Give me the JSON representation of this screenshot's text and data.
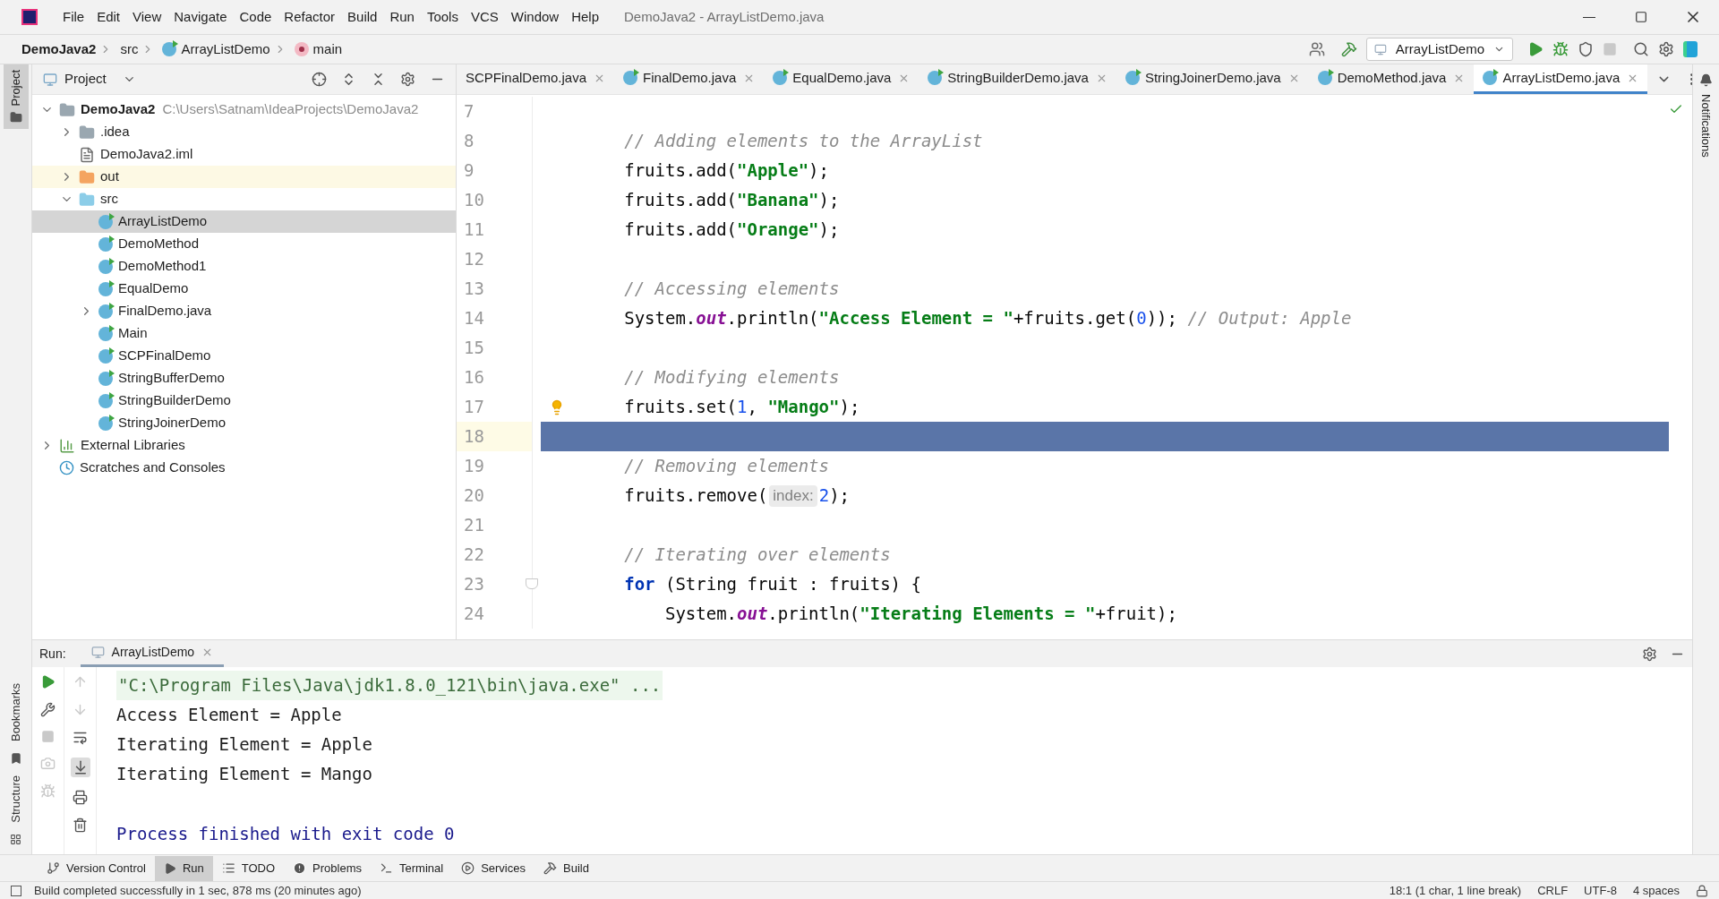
{
  "window": {
    "title": "DemoJava2 - ArrayListDemo.java"
  },
  "menu": [
    "File",
    "Edit",
    "View",
    "Navigate",
    "Code",
    "Refactor",
    "Build",
    "Run",
    "Tools",
    "VCS",
    "Window",
    "Help"
  ],
  "breadcrumb": [
    {
      "label": "DemoJava2",
      "kind": "project"
    },
    {
      "label": "src",
      "kind": "folder"
    },
    {
      "label": "ArrayListDemo",
      "kind": "class"
    },
    {
      "label": "main",
      "kind": "method"
    }
  ],
  "run_config": "ArrayListDemo",
  "left_strip": {
    "top": [
      "Project"
    ],
    "bottom": [
      "Bookmarks",
      "Structure"
    ]
  },
  "right_strip": [
    "Notifications"
  ],
  "project_panel": {
    "title": "Project",
    "tree": [
      {
        "name": "DemoJava2",
        "path": "C:\\Users\\Satnam\\IdeaProjects\\DemoJava2",
        "kind": "module",
        "expanded": true,
        "selected": false,
        "children": [
          {
            "name": ".idea",
            "kind": "folder",
            "expanded": false,
            "selected": false
          },
          {
            "name": "DemoJava2.iml",
            "kind": "iml",
            "selected": false
          },
          {
            "name": "out",
            "kind": "excluded",
            "expanded": false,
            "selected": false
          },
          {
            "name": "src",
            "kind": "source",
            "expanded": true,
            "selected": false,
            "children": [
              {
                "name": "ArrayListDemo",
                "kind": "class",
                "selected": true
              },
              {
                "name": "DemoMethod",
                "kind": "class",
                "selected": false
              },
              {
                "name": "DemoMethod1",
                "kind": "class",
                "selected": false
              },
              {
                "name": "EqualDemo",
                "kind": "class",
                "selected": false
              },
              {
                "name": "FinalDemo.java",
                "kind": "class",
                "expanded": false,
                "selected": false
              },
              {
                "name": "Main",
                "kind": "class",
                "selected": false
              },
              {
                "name": "SCPFinalDemo",
                "kind": "class",
                "selected": false
              },
              {
                "name": "StringBufferDemo",
                "kind": "class",
                "selected": false
              },
              {
                "name": "StringBuilderDemo",
                "kind": "class",
                "selected": false
              },
              {
                "name": "StringJoinerDemo",
                "kind": "class",
                "selected": false
              }
            ]
          }
        ]
      },
      {
        "name": "External Libraries",
        "kind": "libraries",
        "expanded": false,
        "selected": false
      },
      {
        "name": "Scratches and Consoles",
        "kind": "scratches",
        "selected": false
      }
    ]
  },
  "tabs": [
    {
      "label": "SCPFinalDemo.java",
      "selected": false
    },
    {
      "label": "FinalDemo.java",
      "selected": false
    },
    {
      "label": "EqualDemo.java",
      "selected": false
    },
    {
      "label": "StringBuilderDemo.java",
      "selected": false
    },
    {
      "label": "StringJoinerDemo.java",
      "selected": false
    },
    {
      "label": "DemoMethod.java",
      "selected": false
    },
    {
      "label": "ArrayListDemo.java",
      "selected": true
    }
  ],
  "editor": {
    "lines": [
      {
        "number": "7",
        "selected": false
      },
      {
        "number": "8",
        "selected": false,
        "tokens": [
          {
            "kind": "comment",
            "text": "     // Adding elements to the ArrayList"
          }
        ]
      },
      {
        "number": "9",
        "selected": false,
        "tokens": [
          {
            "kind": "plain",
            "text": "     fruits.add("
          },
          {
            "kind": "string",
            "text": "\"Apple\""
          },
          {
            "kind": "plain",
            "text": ");"
          }
        ]
      },
      {
        "number": "10",
        "selected": false,
        "tokens": [
          {
            "kind": "plain",
            "text": "     fruits.add("
          },
          {
            "kind": "string",
            "text": "\"Banana\""
          },
          {
            "kind": "plain",
            "text": ");"
          }
        ]
      },
      {
        "number": "11",
        "selected": false,
        "tokens": [
          {
            "kind": "plain",
            "text": "     fruits.add("
          },
          {
            "kind": "string",
            "text": "\"Orange\""
          },
          {
            "kind": "plain",
            "text": ");"
          }
        ]
      },
      {
        "number": "12",
        "selected": false
      },
      {
        "number": "13",
        "selected": false,
        "tokens": [
          {
            "kind": "comment",
            "text": "     // Accessing elements"
          }
        ]
      },
      {
        "number": "14",
        "selected": false,
        "tokens": [
          {
            "kind": "plain",
            "text": "     System."
          },
          {
            "kind": "field",
            "text": "out"
          },
          {
            "kind": "plain",
            "text": ".println("
          },
          {
            "kind": "string",
            "text": "\"Access Element = \""
          },
          {
            "kind": "plain",
            "text": "+fruits.get("
          },
          {
            "kind": "number",
            "text": "0"
          },
          {
            "kind": "plain",
            "text": ")); "
          },
          {
            "kind": "comment",
            "text": "// Output: Apple"
          }
        ]
      },
      {
        "number": "15",
        "selected": false
      },
      {
        "number": "16",
        "selected": false,
        "tokens": [
          {
            "kind": "comment",
            "text": "     // Modifying elements"
          }
        ]
      },
      {
        "number": "17",
        "selected": false,
        "gutter": {
          "kind": "bulb"
        },
        "tokens": [
          {
            "kind": "plain",
            "text": "     fruits.set("
          },
          {
            "kind": "number",
            "text": "1"
          },
          {
            "kind": "plain",
            "text": ", "
          },
          {
            "kind": "string",
            "text": "\"Mango\""
          },
          {
            "kind": "plain",
            "text": ");"
          }
        ]
      },
      {
        "number": "18",
        "selected": true
      },
      {
        "number": "19",
        "selected": false,
        "tokens": [
          {
            "kind": "comment",
            "text": "     // Removing elements"
          }
        ]
      },
      {
        "number": "20",
        "selected": false,
        "tokens": [
          {
            "kind": "plain",
            "text": "     fruits.remove("
          },
          {
            "kind": "hint",
            "text": "index:"
          },
          {
            "kind": "number",
            "text": "2"
          },
          {
            "kind": "plain",
            "text": ");"
          }
        ]
      },
      {
        "number": "21",
        "selected": false
      },
      {
        "number": "22",
        "selected": false,
        "tokens": [
          {
            "kind": "comment",
            "text": "     // Iterating over elements"
          }
        ]
      },
      {
        "number": "23",
        "selected": false,
        "gutter": {
          "kind": "fold"
        },
        "tokens": [
          {
            "kind": "keyword",
            "text": "     for"
          },
          {
            "kind": "plain",
            "text": " (String fruit : fruits) {"
          }
        ]
      },
      {
        "number": "24",
        "selected": false,
        "tokens": [
          {
            "kind": "plain",
            "text": "         System."
          },
          {
            "kind": "field",
            "text": "out"
          },
          {
            "kind": "plain",
            "text": ".println("
          },
          {
            "kind": "string",
            "text": "\"Iterating Elements = \""
          },
          {
            "kind": "plain",
            "text": "+fruit);"
          }
        ]
      }
    ]
  },
  "run_panel": {
    "label": "Run:",
    "tab": "ArrayListDemo",
    "console": [
      {
        "kind": "command",
        "text": "\"C:\\Program Files\\Java\\jdk1.8.0_121\\bin\\java.exe\" ..."
      },
      {
        "kind": "output",
        "text": "Access Element = Apple"
      },
      {
        "kind": "output",
        "text": "Iterating Element = Apple"
      },
      {
        "kind": "output",
        "text": "Iterating Element = Mango"
      },
      {
        "kind": "exit",
        "text": "Process finished with exit code 0"
      }
    ]
  },
  "tool_tabs": [
    {
      "label": "Version Control",
      "kind": "vcs",
      "selected": false
    },
    {
      "label": "Run",
      "kind": "run",
      "selected": true
    },
    {
      "label": "TODO",
      "kind": "todo",
      "selected": false
    },
    {
      "label": "Problems",
      "kind": "problems",
      "selected": false
    },
    {
      "label": "Terminal",
      "kind": "terminal",
      "selected": false
    },
    {
      "label": "Services",
      "kind": "services",
      "selected": false
    },
    {
      "label": "Build",
      "kind": "build",
      "selected": false
    }
  ],
  "status_bar": {
    "message": "Build completed successfully in 1 sec, 878 ms (20 minutes ago)",
    "items": [
      "18:1 (1 char, 1 line break)",
      "CRLF",
      "UTF-8",
      "4 spaces"
    ]
  }
}
